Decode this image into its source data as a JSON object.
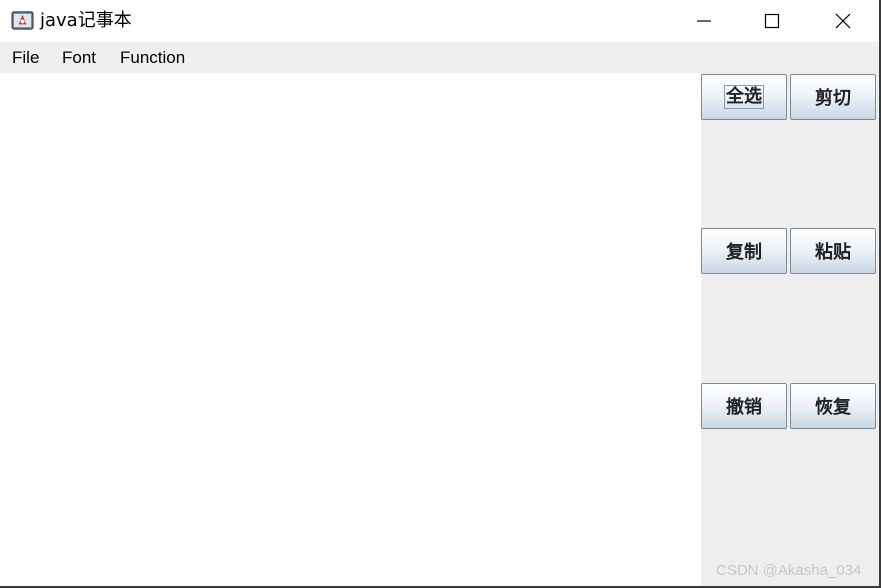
{
  "window": {
    "title": "java记事本",
    "icon": "java-app-icon",
    "controls": [
      "minimize-icon",
      "maximize-icon",
      "close-icon"
    ]
  },
  "menubar": {
    "items": [
      {
        "label": "File"
      },
      {
        "label": "Font"
      },
      {
        "label": "Function"
      }
    ]
  },
  "editor": {
    "text": ""
  },
  "buttons": [
    {
      "label": "全选",
      "focused": true
    },
    {
      "label": "剪切"
    },
    {
      "label": "复制"
    },
    {
      "label": "粘贴"
    },
    {
      "label": "撤销"
    },
    {
      "label": "恢复"
    }
  ],
  "watermark": "CSDN @Akasha_034",
  "colors": {
    "menubar_bg": "#efefef",
    "panel_bg": "#eeeeee",
    "button_gradient_bottom": "#c9d8e6"
  }
}
